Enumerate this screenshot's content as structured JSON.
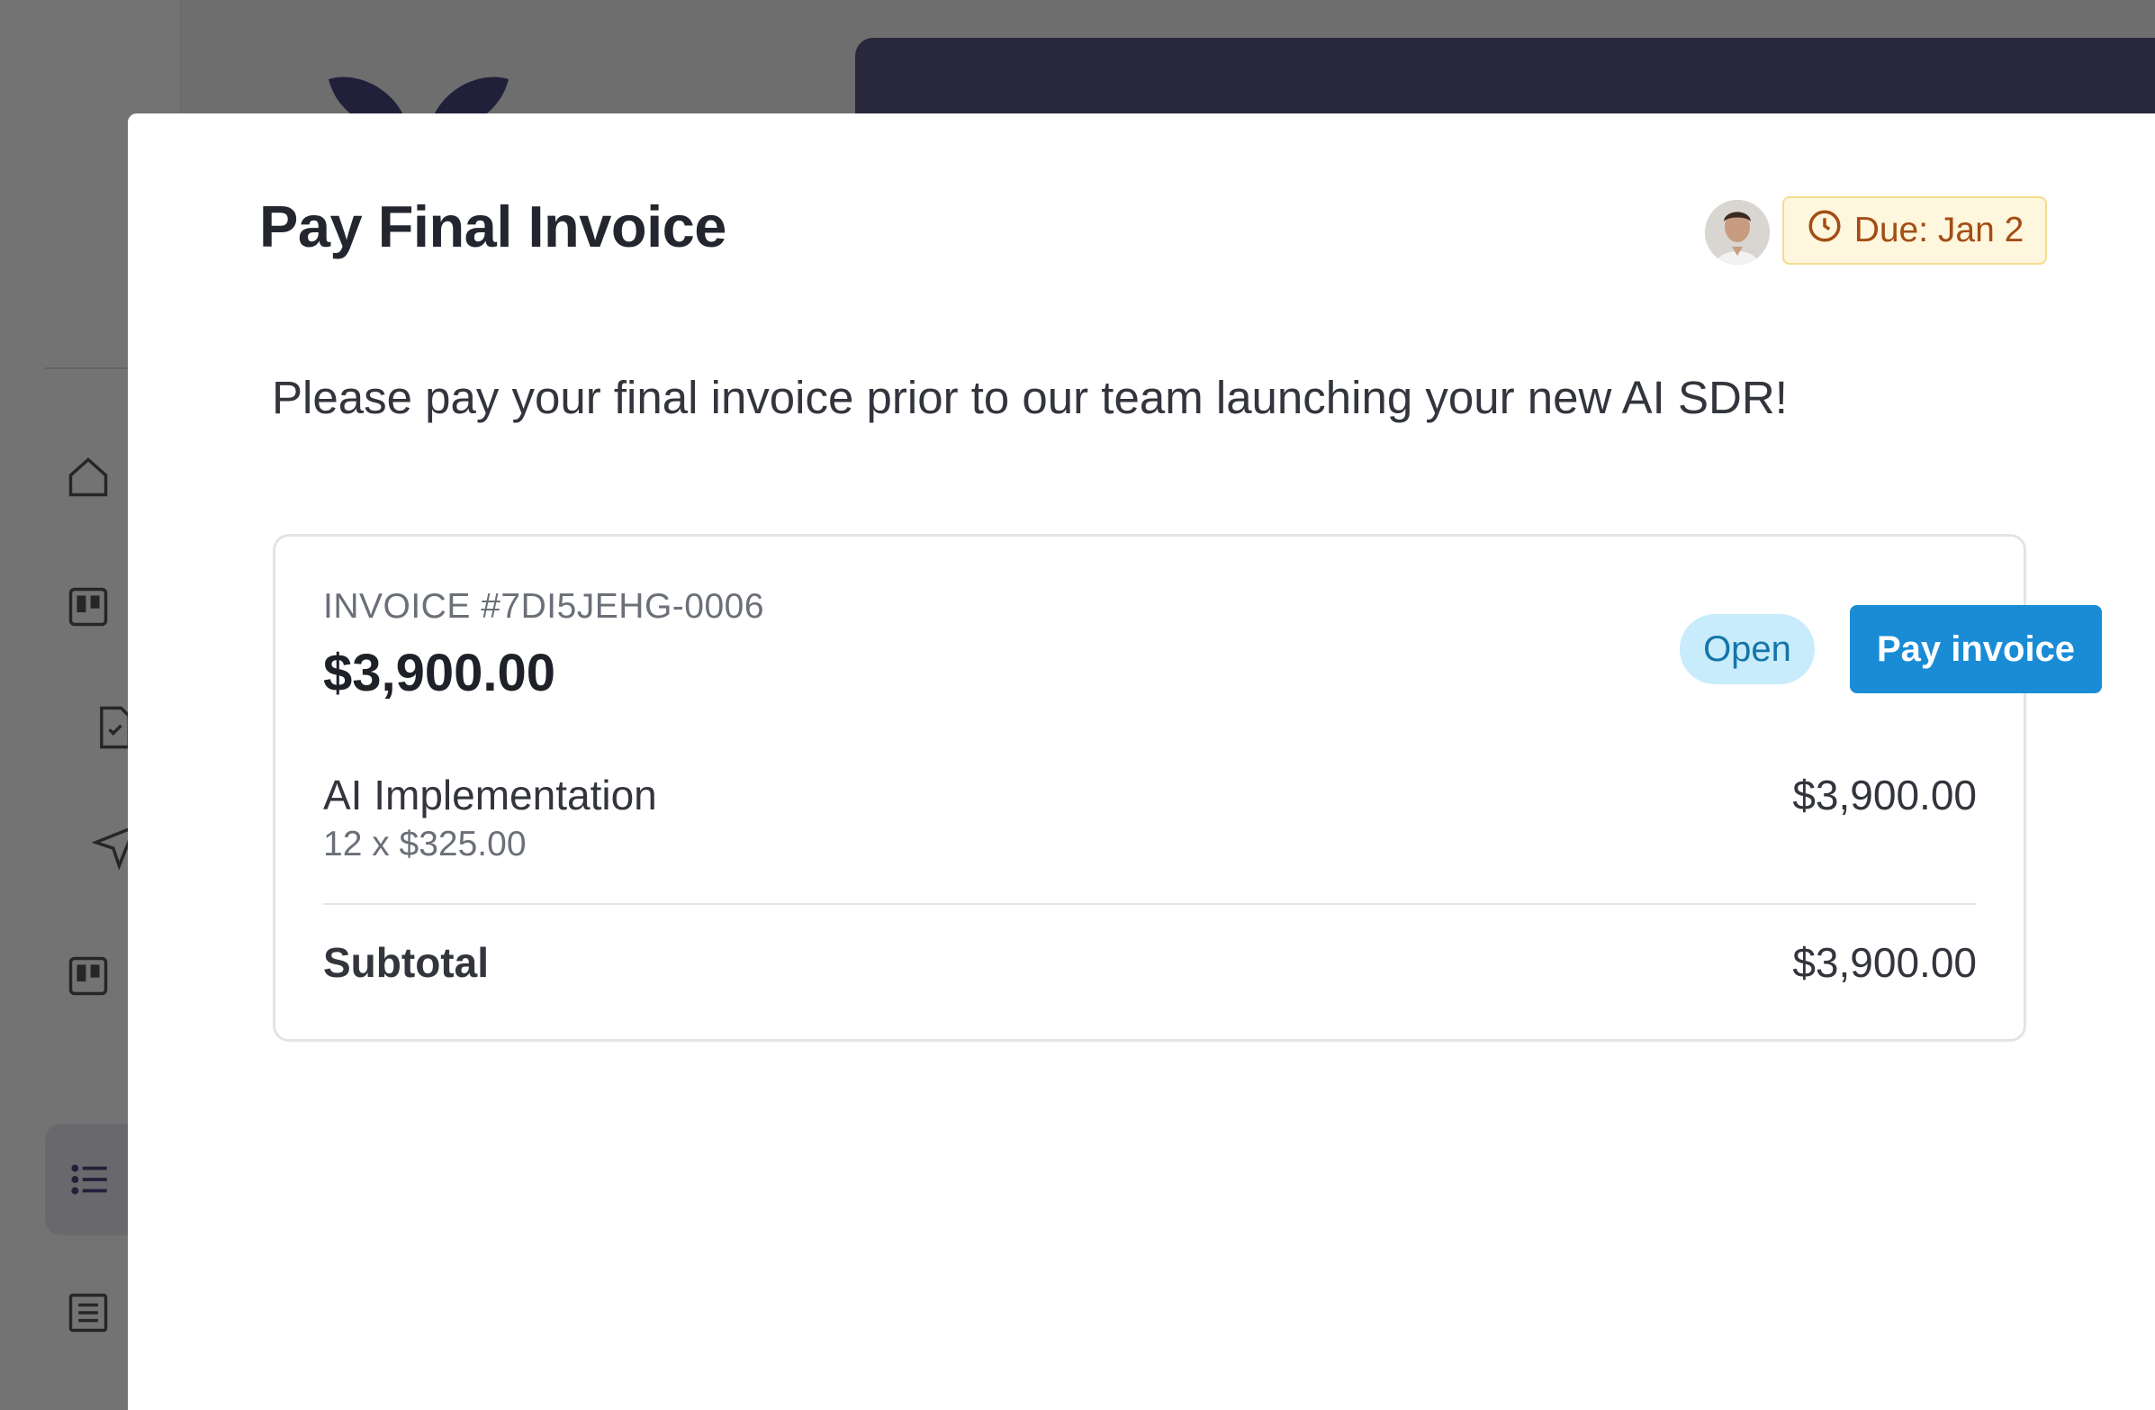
{
  "modal": {
    "title": "Pay Final Invoice",
    "due_badge": {
      "icon": "clock-icon",
      "text": "Due: Jan 2"
    },
    "description": "Please pay your final invoice prior to our team launching your new AI SDR!"
  },
  "invoice": {
    "number": "INVOICE #7DI5JEHG-0006",
    "amount": "$3,900.00",
    "status": "Open",
    "pay_button_label": "Pay invoice",
    "line_items": [
      {
        "name": "AI Implementation",
        "quantity_detail": "12 x $325.00",
        "price": "$3,900.00"
      }
    ],
    "subtotal_label": "Subtotal",
    "subtotal_value": "$3,900.00"
  },
  "background_nav_icons": [
    "home-icon",
    "board-icon",
    "document-check-icon",
    "send-icon",
    "board-icon",
    "list-icon",
    "newspaper-icon"
  ],
  "colors": {
    "brand_purple": "#5a5785",
    "pay_button": "#1a8cd6",
    "status_open_bg": "#c8ecfb",
    "due_badge_bg": "#fef6dd",
    "due_badge_text": "#a34d14"
  }
}
